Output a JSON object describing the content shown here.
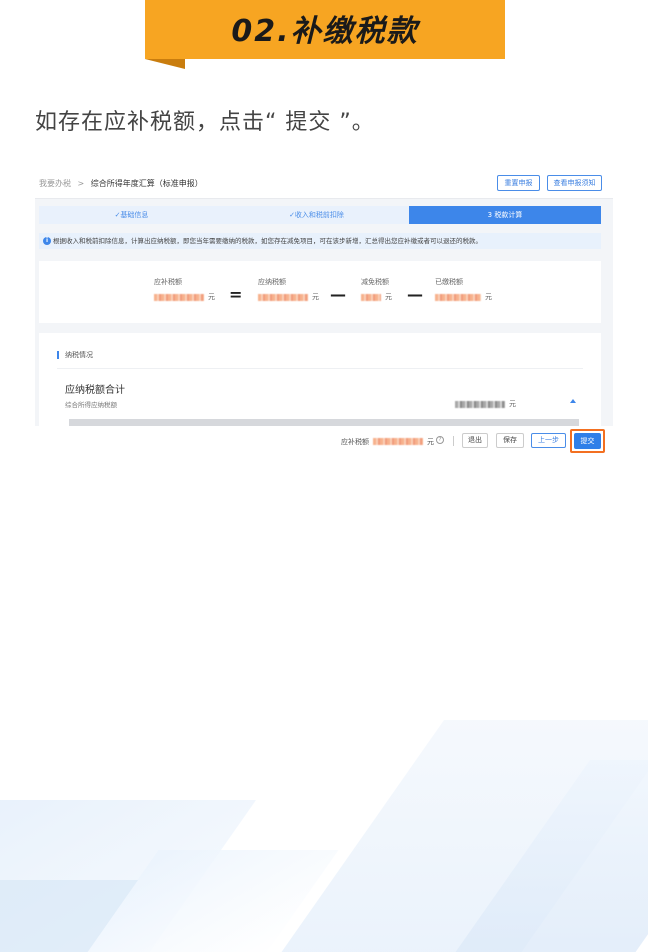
{
  "header": {
    "title": "02.补缴税款"
  },
  "intro": {
    "text": "如存在应补税额，点击“ 提交 ”。"
  },
  "screenshot": {
    "breadcrumb": {
      "root": "我要办税",
      "separator": ">",
      "current": "综合所得年度汇算（标准申报）"
    },
    "top_buttons": {
      "reset": "重置申报",
      "notice": "查看申报须知"
    },
    "steps": [
      {
        "label": "✓基础信息"
      },
      {
        "label": "✓收入和税前扣除"
      },
      {
        "label": "3 税款计算"
      }
    ],
    "notice_text": "根据收入和税前扣除信息，计算出应纳税额，即您当年需要缴纳的税款，如您存在减免项目，可在该步新增，汇总得出您应补缴或者可以退还的税款。",
    "calc": {
      "items": [
        {
          "label": "应补税额",
          "unit": "元"
        },
        {
          "label": "应纳税额",
          "unit": "元"
        },
        {
          "label": "减免税额",
          "unit": "元"
        },
        {
          "label": "已缴税额",
          "unit": "元"
        }
      ],
      "operators": [
        "=",
        "—",
        "—"
      ]
    },
    "detail": {
      "section_title": "纳税情况",
      "sum_title": "应纳税额合计",
      "sum_sub": "综合所得应纳税额",
      "sum_unit": "元"
    }
  },
  "action_bar": {
    "label": "应补税额",
    "unit": "元",
    "buttons": {
      "exit": "退出",
      "save": "保存",
      "prev": "上一步",
      "submit": "提交"
    }
  },
  "colors": {
    "accent": "#3d86ea",
    "banner": "#f7a522",
    "highlight": "#f37021"
  }
}
